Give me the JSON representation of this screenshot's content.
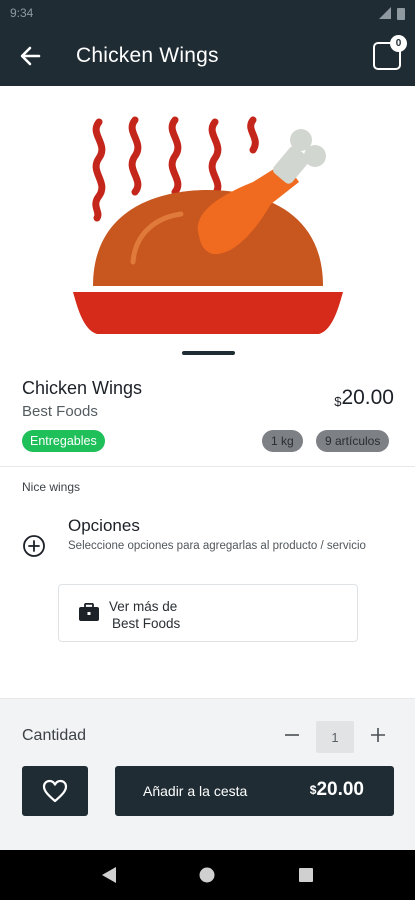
{
  "status_bar": {
    "time": "9:34"
  },
  "app_bar": {
    "title": "Chicken Wings",
    "cart_count": "0"
  },
  "product": {
    "name": "Chicken Wings",
    "vendor": "Best Foods",
    "price_currency": "$",
    "price_amount": "20.00",
    "badge": "Entregables",
    "chips": [
      "1 kg",
      "9 artículos"
    ],
    "description": "Nice wings"
  },
  "options": {
    "title": "Opciones",
    "subtitle": "Seleccione opciones para agregarlas al producto / servicio"
  },
  "vendor_card": {
    "line1": "Ver más de",
    "line2": "Best Foods"
  },
  "quantity": {
    "label": "Cantidad",
    "value": "1"
  },
  "add_to_cart": {
    "label": "Añadir a la cesta",
    "currency": "$",
    "amount": "20.00"
  },
  "colors": {
    "primary": "#1f2c33",
    "badge_green": "#1fbf5a",
    "chip_gray": "#7d8186",
    "chicken_body": "#c8561f",
    "plate_red": "#d62a1a",
    "steam_red": "#c4261b"
  },
  "icons": {
    "back": "arrow-left-icon",
    "cart": "cart-icon",
    "options": "plus-circle-icon",
    "vendor": "briefcase-icon",
    "favorite": "heart-icon",
    "nav_back": "triangle-back-icon",
    "nav_home": "circle-home-icon",
    "nav_recent": "square-recent-icon"
  }
}
